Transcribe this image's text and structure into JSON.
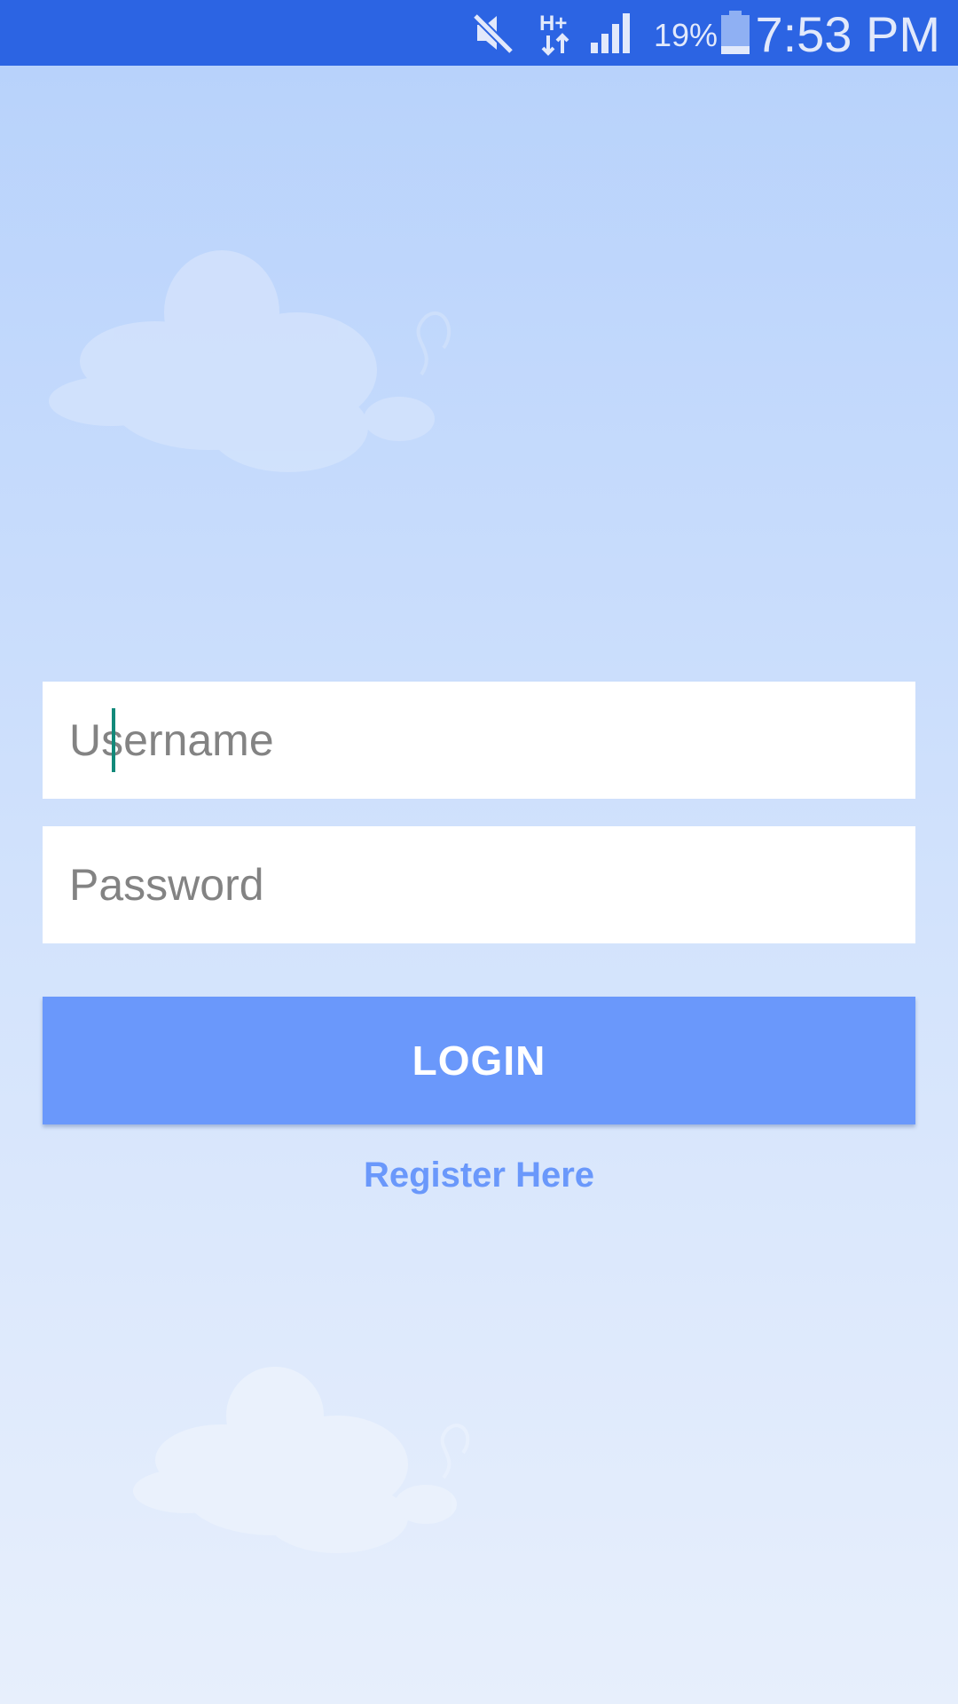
{
  "status_bar": {
    "network_type": "H+",
    "battery_percent": "19%",
    "time": "7:53 PM",
    "icons": [
      "mute-icon",
      "network-type-icon",
      "signal-icon",
      "battery-icon"
    ],
    "background_color": "#2c64e3"
  },
  "login_form": {
    "username_placeholder": "Username",
    "username_value": "",
    "password_placeholder": "Password",
    "password_value": "",
    "login_label": "LOGIN",
    "register_label": "Register Here",
    "accent_color": "#6a98fb",
    "cursor_color": "#12897a"
  }
}
